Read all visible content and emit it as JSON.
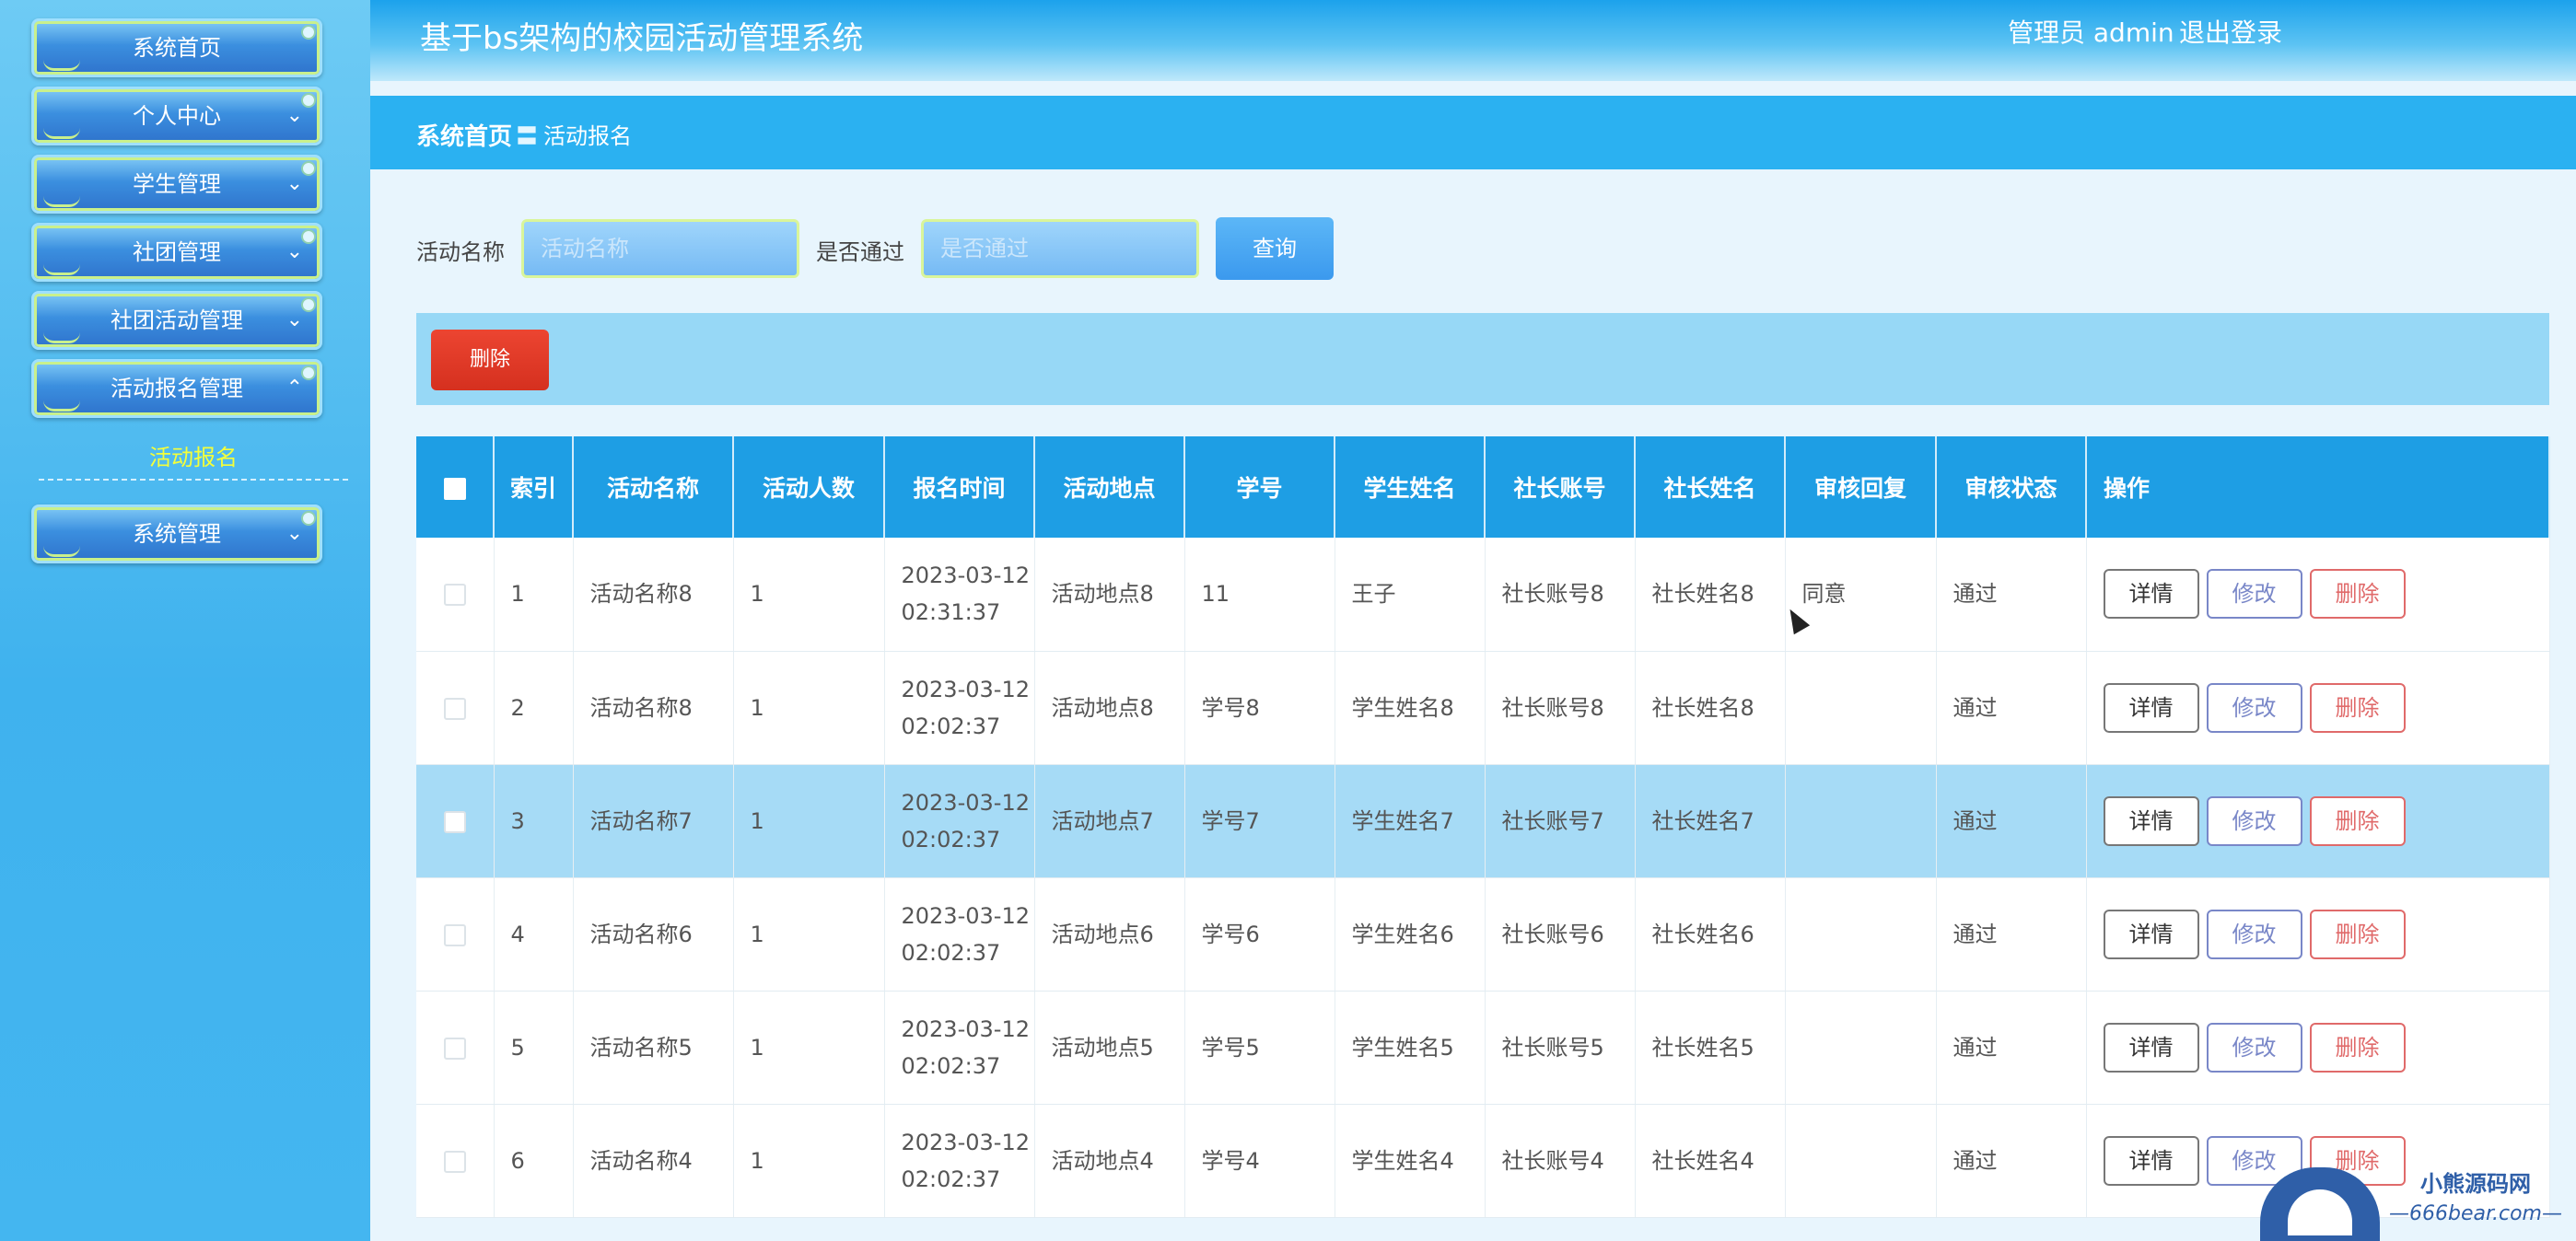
{
  "app": {
    "title": "基于bs架构的校园活动管理系统",
    "user": "管理员 admin",
    "logout": "退出登录"
  },
  "sidebar": {
    "items": [
      {
        "label": "系统首页"
      },
      {
        "label": "个人中心"
      },
      {
        "label": "学生管理"
      },
      {
        "label": "社团管理"
      },
      {
        "label": "社团活动管理"
      },
      {
        "label": "活动报名管理"
      }
    ],
    "active_sub": "活动报名",
    "system": "系统管理"
  },
  "breadcrumb": {
    "home": "系统首页",
    "separator": "〓",
    "current": "活动报名"
  },
  "search": {
    "name_label": "活动名称",
    "name_placeholder": "活动名称",
    "pass_label": "是否通过",
    "pass_placeholder": "是否通过",
    "query_label": "查询"
  },
  "toolbar": {
    "delete_label": "删除"
  },
  "table": {
    "headers": [
      "索引",
      "活动名称",
      "活动人数",
      "报名时间",
      "活动地点",
      "学号",
      "学生姓名",
      "社长账号",
      "社长姓名",
      "审核回复",
      "审核状态",
      "操作"
    ],
    "rows": [
      {
        "index": "1",
        "name": "活动名称8",
        "count": "1",
        "time": "2023-03-12 02:31:37",
        "place": "活动地点8",
        "sid": "11",
        "sname": "王子",
        "leader_acc": "社长账号8",
        "leader_name": "社长姓名8",
        "reply": "同意",
        "status": "通过"
      },
      {
        "index": "2",
        "name": "活动名称8",
        "count": "1",
        "time": "2023-03-12 02:02:37",
        "place": "活动地点8",
        "sid": "学号8",
        "sname": "学生姓名8",
        "leader_acc": "社长账号8",
        "leader_name": "社长姓名8",
        "reply": "",
        "status": "通过"
      },
      {
        "index": "3",
        "name": "活动名称7",
        "count": "1",
        "time": "2023-03-12 02:02:37",
        "place": "活动地点7",
        "sid": "学号7",
        "sname": "学生姓名7",
        "leader_acc": "社长账号7",
        "leader_name": "社长姓名7",
        "reply": "",
        "status": "通过"
      },
      {
        "index": "4",
        "name": "活动名称6",
        "count": "1",
        "time": "2023-03-12 02:02:37",
        "place": "活动地点6",
        "sid": "学号6",
        "sname": "学生姓名6",
        "leader_acc": "社长账号6",
        "leader_name": "社长姓名6",
        "reply": "",
        "status": "通过"
      },
      {
        "index": "5",
        "name": "活动名称5",
        "count": "1",
        "time": "2023-03-12 02:02:37",
        "place": "活动地点5",
        "sid": "学号5",
        "sname": "学生姓名5",
        "leader_acc": "社长账号5",
        "leader_name": "社长姓名5",
        "reply": "",
        "status": "通过"
      },
      {
        "index": "6",
        "name": "活动名称4",
        "count": "1",
        "time": "2023-03-12 02:02:37",
        "place": "活动地点4",
        "sid": "学号4",
        "sname": "学生姓名4",
        "leader_acc": "社长账号4",
        "leader_name": "社长姓名4",
        "reply": "",
        "status": "通过"
      }
    ],
    "ops": {
      "detail": "详情",
      "edit": "修改",
      "remove": "删除"
    }
  },
  "watermark": {
    "brand": "小熊源码网",
    "site": "—666bear.com—"
  },
  "colors": {
    "header": "#1ca2ec",
    "breadcrumb": "#2bb1f1",
    "table_header": "#1e9ee4",
    "active_sub": "#f4ff3a",
    "delete": "#e0402b"
  }
}
